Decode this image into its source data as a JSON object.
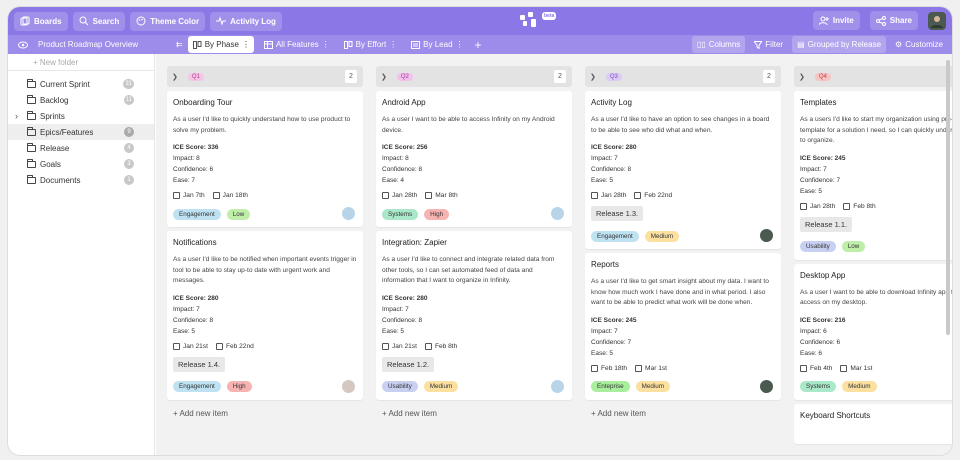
{
  "topbar": {
    "boards": "Boards",
    "search": "Search",
    "theme": "Theme Color",
    "activity": "Activity Log",
    "beta": "beta",
    "invite": "Invite",
    "share": "Share"
  },
  "toolbar": {
    "title": "Product Roadmap Overview",
    "tabs": [
      "By Phase",
      "All Features",
      "By Effort",
      "By Lead"
    ],
    "columns": "Columns",
    "filter": "Filter",
    "grouped": "Grouped by Release",
    "customize": "Customize"
  },
  "sidebar": {
    "new_folder": "+ New folder",
    "items": [
      {
        "label": "Current Sprint",
        "count": "31"
      },
      {
        "label": "Backlog",
        "count": "11"
      },
      {
        "label": "Sprints",
        "count": ""
      },
      {
        "label": "Epics/Features",
        "count": "9"
      },
      {
        "label": "Release",
        "count": "4"
      },
      {
        "label": "Goals",
        "count": "3"
      },
      {
        "label": "Documents",
        "count": "1"
      }
    ]
  },
  "colors": {
    "accent": "#8b78e6",
    "q1": "#f4c6e6",
    "q2": "#f0c2ec",
    "q3": "#dccbf4",
    "q4": "#f7c4c4"
  },
  "columns": [
    {
      "label": "Q1",
      "count": "2",
      "cards": [
        {
          "title": "Onboarding Tour",
          "desc": "As a user I'd like to quickly understand how to use product to solve my problem.",
          "ice": "ICE Score: 336",
          "impact": "Impact: 8",
          "confidence": "Confidence: 6",
          "ease": "Ease: 7",
          "start": "Jan 7th",
          "end": "Jan 18th",
          "release": "",
          "tag1": "Engagement",
          "tag2": "Low"
        },
        {
          "title": "Notifications",
          "desc": "As a user I'd like to be notified when important events trigger in tool to be able to stay up-to date with urgent work and messages.",
          "ice": "ICE Score: 280",
          "impact": "Impact: 7",
          "confidence": "Confidence: 8",
          "ease": "Ease: 5",
          "start": "Jan 21st",
          "end": "Feb 22nd",
          "release": "Release 1.4.",
          "tag1": "Engagement",
          "tag2": "High"
        }
      ],
      "add": "+ Add new item"
    },
    {
      "label": "Q2",
      "count": "2",
      "cards": [
        {
          "title": "Android App",
          "desc": "As a user I want to be able to access Infinity on my Android device.",
          "ice": "ICE Score: 256",
          "impact": "Impact: 8",
          "confidence": "Confidence: 8",
          "ease": "Ease: 4",
          "start": "Jan 28th",
          "end": "Mar 8th",
          "release": "",
          "tag1": "Systems",
          "tag2": "High"
        },
        {
          "title": "Integration: Zapier",
          "desc": "As a user I'd like to connect and integrate related data from other tools, so I can set automated feed of data and information that I want to organize in Infinity.",
          "ice": "ICE Score: 280",
          "impact": "Impact: 7",
          "confidence": "Confidence: 8",
          "ease": "Ease: 5",
          "start": "Jan 21st",
          "end": "Feb 8th",
          "release": "Release 1.2.",
          "tag1": "Usability",
          "tag2": "Medium"
        }
      ],
      "add": "+ Add new item"
    },
    {
      "label": "Q3",
      "count": "2",
      "cards": [
        {
          "title": "Activity Log",
          "desc": "As a user I'd like to have an option to see changes in a board to be able to see who did what and when.",
          "ice": "ICE Score: 280",
          "impact": "Impact: 7",
          "confidence": "Confidence: 8",
          "ease": "Ease: 5",
          "start": "Jan 28th",
          "end": "Feb 22nd",
          "release": "Release 1.3.",
          "tag1": "Engagement",
          "tag2": "Medium"
        },
        {
          "title": "Reports",
          "desc": "As a user I'd like to get smart insight about my data. I want to know how much work I have done and in what period. I also want to be able to predict what work will be done when.",
          "ice": "ICE Score: 245",
          "impact": "Impact: 7",
          "confidence": "Confidence: 7",
          "ease": "Ease: 5",
          "start": "Feb 18th",
          "end": "Mar 1st",
          "release": "",
          "tag1": "Enteprise",
          "tag2": "Medium"
        }
      ],
      "add": "+ Add new item"
    },
    {
      "label": "Q4",
      "count": "",
      "cards": [
        {
          "title": "Templates",
          "desc": "As a users I'd like to start my organization using pre-defined template for a solution I need, so I can quickly understand how to organize.",
          "ice": "ICE Score: 245",
          "impact": "Impact: 7",
          "confidence": "Confidence: 7",
          "ease": "Ease: 5",
          "start": "Jan 28th",
          "end": "Feb 8th",
          "release": "Release 1.1.",
          "tag1": "Usability",
          "tag2": "Low"
        },
        {
          "title": "Desktop App",
          "desc": "As a user I want to be able to download Infinity app for quicker access on my desktop.",
          "ice": "ICE Score: 216",
          "impact": "Impact: 6",
          "confidence": "Confidence: 6",
          "ease": "Ease: 6",
          "start": "Feb 4th",
          "end": "Mar 1st",
          "release": "",
          "tag1": "Systems",
          "tag2": "Medium"
        },
        {
          "title": "Keyboard Shortcuts",
          "desc": "",
          "ice": "",
          "impact": "",
          "confidence": "",
          "ease": "",
          "start": "",
          "end": "",
          "release": "",
          "tag1": "",
          "tag2": ""
        }
      ],
      "add": ""
    }
  ]
}
